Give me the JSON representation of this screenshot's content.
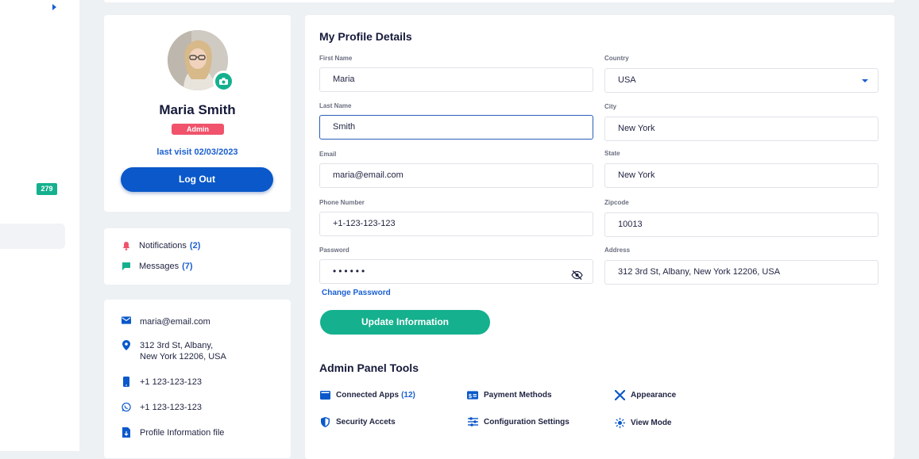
{
  "sidebar": {
    "badge_count": "279"
  },
  "profile": {
    "name": "Maria Smith",
    "role": "Admin",
    "last_visit": "last visit 02/03/2023",
    "logout_label": "Log Out"
  },
  "notifications": {
    "notifications_label": "Notifications",
    "notifications_count": "(2)",
    "messages_label": "Messages",
    "messages_count": "(7)"
  },
  "contact": {
    "email": "maria@email.com",
    "address_line1": "312 3rd St, Albany,",
    "address_line2": "New York 12206, USA",
    "phone": "+1 123-123-123",
    "whatsapp": "+1 123-123-123",
    "file_label": "Profile Information file"
  },
  "form": {
    "title": "My Profile Details",
    "first_name_label": "First Name",
    "first_name": "Maria",
    "last_name_label": "Last Name",
    "last_name": "Smith",
    "email_label": "Email",
    "email": "maria@email.com",
    "phone_label": "Phone Number",
    "phone": "+1-123-123-123",
    "password_label": "Password",
    "password_masked": "••••••",
    "country_label": "Country",
    "country": "USA",
    "city_label": "City",
    "city": "New York",
    "state_label": "State",
    "state": "New York",
    "zip_label": "Zipcode",
    "zip": "10013",
    "address_label": "Address",
    "address": "312 3rd St, Albany, New York 12206, USA",
    "change_password": "Change Password",
    "update_label": "Update Information"
  },
  "admin_tools": {
    "title": "Admin Panel Tools",
    "connected_apps": "Connected Apps",
    "connected_apps_count": "(12)",
    "payment_methods": "Payment Methods",
    "appearance": "Appearance",
    "security": "Security Accets",
    "configuration": "Configuration Settings",
    "view_mode": "View Mode"
  },
  "colors": {
    "primary": "#0a58ca",
    "accent": "#15b08e",
    "danger": "#f0536b"
  }
}
